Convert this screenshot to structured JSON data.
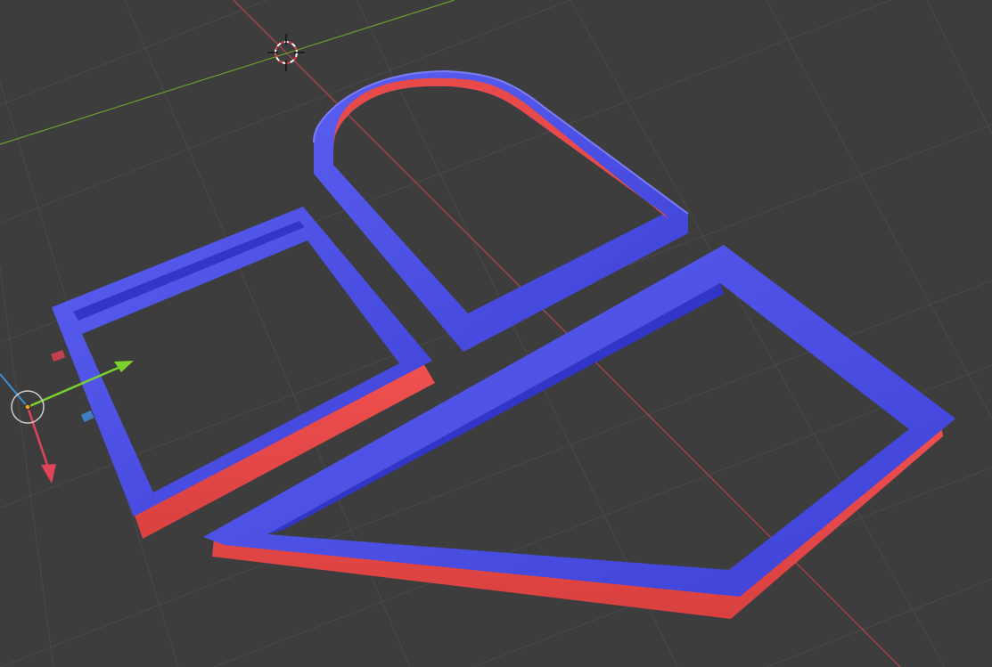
{
  "viewport": {
    "name": "3D Viewport",
    "background_color": "#3d3d3d",
    "grid_color": "#4a4a4a",
    "x_axis_color": "#b8474d",
    "y_axis_color": "#6b9e2c"
  },
  "objects": [
    {
      "name": "arch-frame",
      "top_color": "#4b4fe6",
      "side_color": "#e84a4a"
    },
    {
      "name": "rectangle-frame",
      "top_color": "#4b4fe6",
      "side_color": "#e84a4a"
    },
    {
      "name": "pentagon-frame",
      "top_color": "#4b4fe6",
      "side_color": "#e84a4a"
    }
  ],
  "gizmo": {
    "x_color": "#e0435a",
    "y_color": "#7ad12e",
    "z_color": "#3d8fd6",
    "pivot_color": "#f2a12e"
  },
  "cursor": {
    "name": "3d-cursor",
    "colors": [
      "#e63946",
      "#ffffff"
    ]
  }
}
